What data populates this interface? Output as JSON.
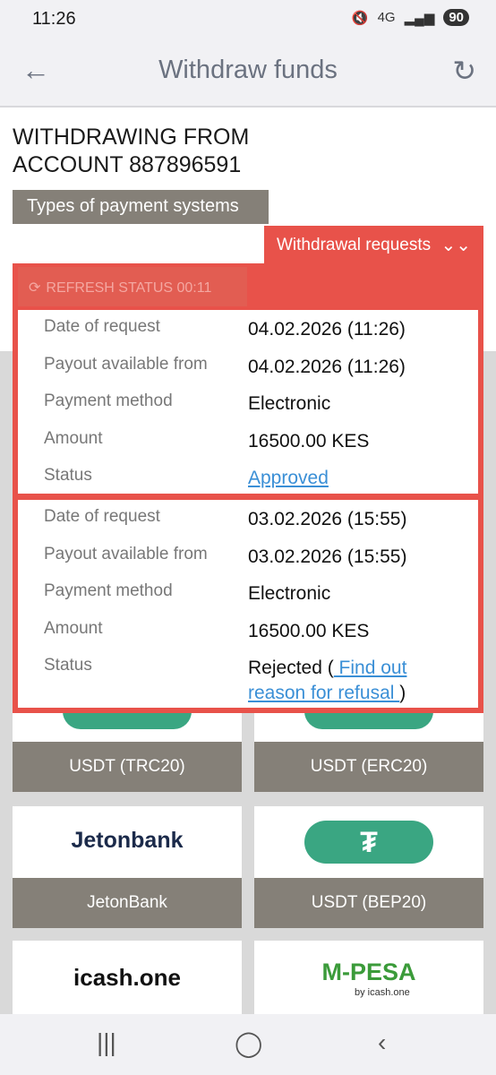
{
  "status_bar": {
    "time": "11:26",
    "network": "4G",
    "battery": "90"
  },
  "header": {
    "title": "Withdraw funds"
  },
  "heading": {
    "line1": "WITHDRAWING FROM",
    "line2": "ACCOUNT 887896591"
  },
  "tabs": {
    "types": "Types of payment systems",
    "requests": "Withdrawal requests"
  },
  "refresh": {
    "label": "REFRESH STATUS 00:11"
  },
  "labels": {
    "date": "Date of request",
    "payout": "Payout available from",
    "method": "Payment method",
    "amount": "Amount",
    "status": "Status"
  },
  "requests": [
    {
      "date": "04.02.2026 (11:26)",
      "payout": "04.02.2026 (11:26)",
      "method": "Electronic",
      "amount": "16500.00 KES",
      "status": "Approved"
    },
    {
      "date": "03.02.2026 (15:55)",
      "payout": "03.02.2026 (15:55)",
      "method": "Electronic",
      "amount": "16500.00 KES",
      "status_prefix": "Rejected (",
      "status_link_1": " Find out",
      "status_link_2": "reason for refusal ",
      "status_suffix": ")"
    }
  ],
  "payment_systems": [
    {
      "name": "USDT (TRC20)"
    },
    {
      "name": "USDT (ERC20)"
    },
    {
      "name": "JetonBank",
      "logo_text": "Jetonbank"
    },
    {
      "name": "USDT (BEP20)",
      "logo_text": "₮"
    },
    {
      "logo_text": "icash.one"
    },
    {
      "logo_text": "M-PESA",
      "logo_sub": "by icash.one"
    }
  ],
  "colors": {
    "accent": "#e8524a",
    "tab_grey": "#858078",
    "tether_green": "#3aa682",
    "link": "#3a8fd6"
  }
}
